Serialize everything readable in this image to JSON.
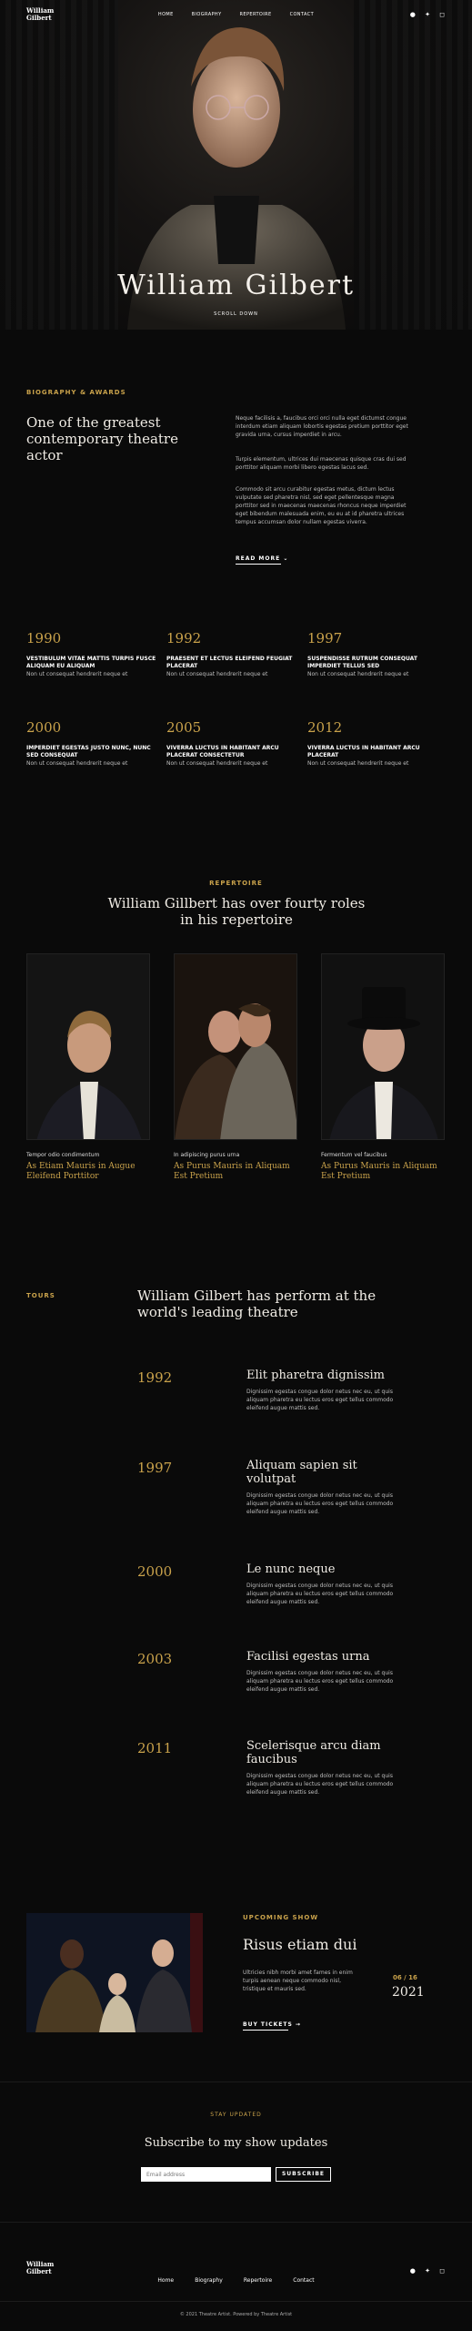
{
  "nav": {
    "logo_line1": "William",
    "logo_line2": "Gilbert",
    "items": [
      "HOME",
      "BIOGRAPHY",
      "REPERTOIRE",
      "CONTACT"
    ],
    "social_icons": [
      "facebook-icon",
      "twitter-icon",
      "instagram-icon"
    ]
  },
  "hero": {
    "title": "William Gilbert",
    "scroll": "SCROLL DOWN"
  },
  "bio": {
    "label": "BIOGRAPHY & AWARDS",
    "heading": "One of the greatest contemporary theatre actor",
    "p1": "Neque facilisis a, faucibus orci orci nulla eget dictumst congue interdum etiam aliquam lobortis egestas pretium porttitor eget gravida urna, cursus imperdiet in arcu.",
    "p2": "Turpis elementum, ultrices dui maecenas quisque cras dui sed porttitor aliquam morbi libero egestas lacus sed.",
    "p3": "Commodo sit arcu curabitur egestas metus, dictum lectus vulputate sed pharetra nisl, sed eget pellentesque magna porttitor sed in maecenas maecenas rhoncus neque imperdiet eget bibendum malesuada enim, eu eu at id pharetra ultrices tempus accumsan dolor nullam egestas viverra.",
    "read_more": "READ MORE"
  },
  "milestones": [
    {
      "year": "1990",
      "title": "VESTIBULUM VITAE MATTIS TURPIS FUSCE ALIQUAM EU ALIQUAM",
      "text": "Non ut consequat hendrerit neque et"
    },
    {
      "year": "1992",
      "title": "PRAESENT ET LECTUS ELEIFEND FEUGIAT PLACERAT",
      "text": "Non ut consequat hendrerit neque et"
    },
    {
      "year": "1997",
      "title": "SUSPENDISSE RUTRUM CONSEQUAT IMPERDIET TELLUS SED",
      "text": "Non ut consequat hendrerit neque et"
    },
    {
      "year": "2000",
      "title": "IMPERDIET EGESTAS JUSTO NUNC, NUNC SED CONSEQUAT",
      "text": "Non ut consequat hendrerit neque et"
    },
    {
      "year": "2005",
      "title": "VIVERRA LUCTUS IN HABITANT ARCU PLACERAT CONSECTETUR",
      "text": "Non ut consequat hendrerit neque et"
    },
    {
      "year": "2012",
      "title": "VIVERRA LUCTUS IN HABITANT ARCU PLACERAT",
      "text": "Non ut consequat hendrerit neque et"
    }
  ],
  "repertoire": {
    "label": "REPERTOIRE",
    "heading": "William Gillbert has over fourty roles in his repertoire",
    "cards": [
      {
        "sub": "Tempor odio condimentum",
        "title": "As Etiam Mauris in Augue Eleifend Porttitor"
      },
      {
        "sub": "In adipiscing purus urna",
        "title": "As Purus Mauris in Aliquam Est Pretium"
      },
      {
        "sub": "Fermentum vel faucibus",
        "title": "As Purus Mauris in Aliquam Est Pretium"
      }
    ]
  },
  "tours": {
    "label": "TOURS",
    "heading": "William Gilbert has perform at the world's leading theatre",
    "items": [
      {
        "year": "1992",
        "title": "Elit pharetra dignissim",
        "text": "Dignissim egestas congue dolor netus nec eu, ut quis aliquam pharetra eu lectus eros eget tellus commodo eleifend augue mattis sed."
      },
      {
        "year": "1997",
        "title": "Aliquam sapien sit volutpat",
        "text": "Dignissim egestas congue dolor netus nec eu, ut quis aliquam pharetra eu lectus eros eget tellus commodo eleifend augue mattis sed."
      },
      {
        "year": "2000",
        "title": "Le nunc neque",
        "text": "Dignissim egestas congue dolor netus nec eu, ut quis aliquam pharetra eu lectus eros eget tellus commodo eleifend augue mattis sed."
      },
      {
        "year": "2003",
        "title": "Facilisi egestas urna",
        "text": "Dignissim egestas congue dolor netus nec eu, ut quis aliquam pharetra eu lectus eros eget tellus commodo eleifend augue mattis sed."
      },
      {
        "year": "2011",
        "title": "Scelerisque arcu diam faucibus",
        "text": "Dignissim egestas congue dolor netus nec eu, ut quis aliquam pharetra eu lectus eros eget tellus commodo eleifend augue mattis sed."
      }
    ]
  },
  "show": {
    "label": "UPCOMING SHOW",
    "title": "Risus etiam dui",
    "text": "Ultricies nibh morbi amet fames in enim turpis aenean neque commodo nisl, tristique et mauris sed.",
    "date": "06 / 16",
    "year": "2021",
    "button": "BUY TICKETS"
  },
  "subscribe": {
    "label": "STAY UPDATED",
    "heading": "Subscribe to my show updates",
    "placeholder": "Email address",
    "button": "SUBSCRIBE"
  },
  "footer": {
    "logo_line1": "William",
    "logo_line2": "Gilbert",
    "links": [
      "Home",
      "Biography",
      "Repertoire",
      "Contact"
    ],
    "copyright": "© 2021 Theatre Artist. Powered by Theatre Artist"
  },
  "colors": {
    "accent": "#c9a24b",
    "background": "#0a0a0a"
  }
}
